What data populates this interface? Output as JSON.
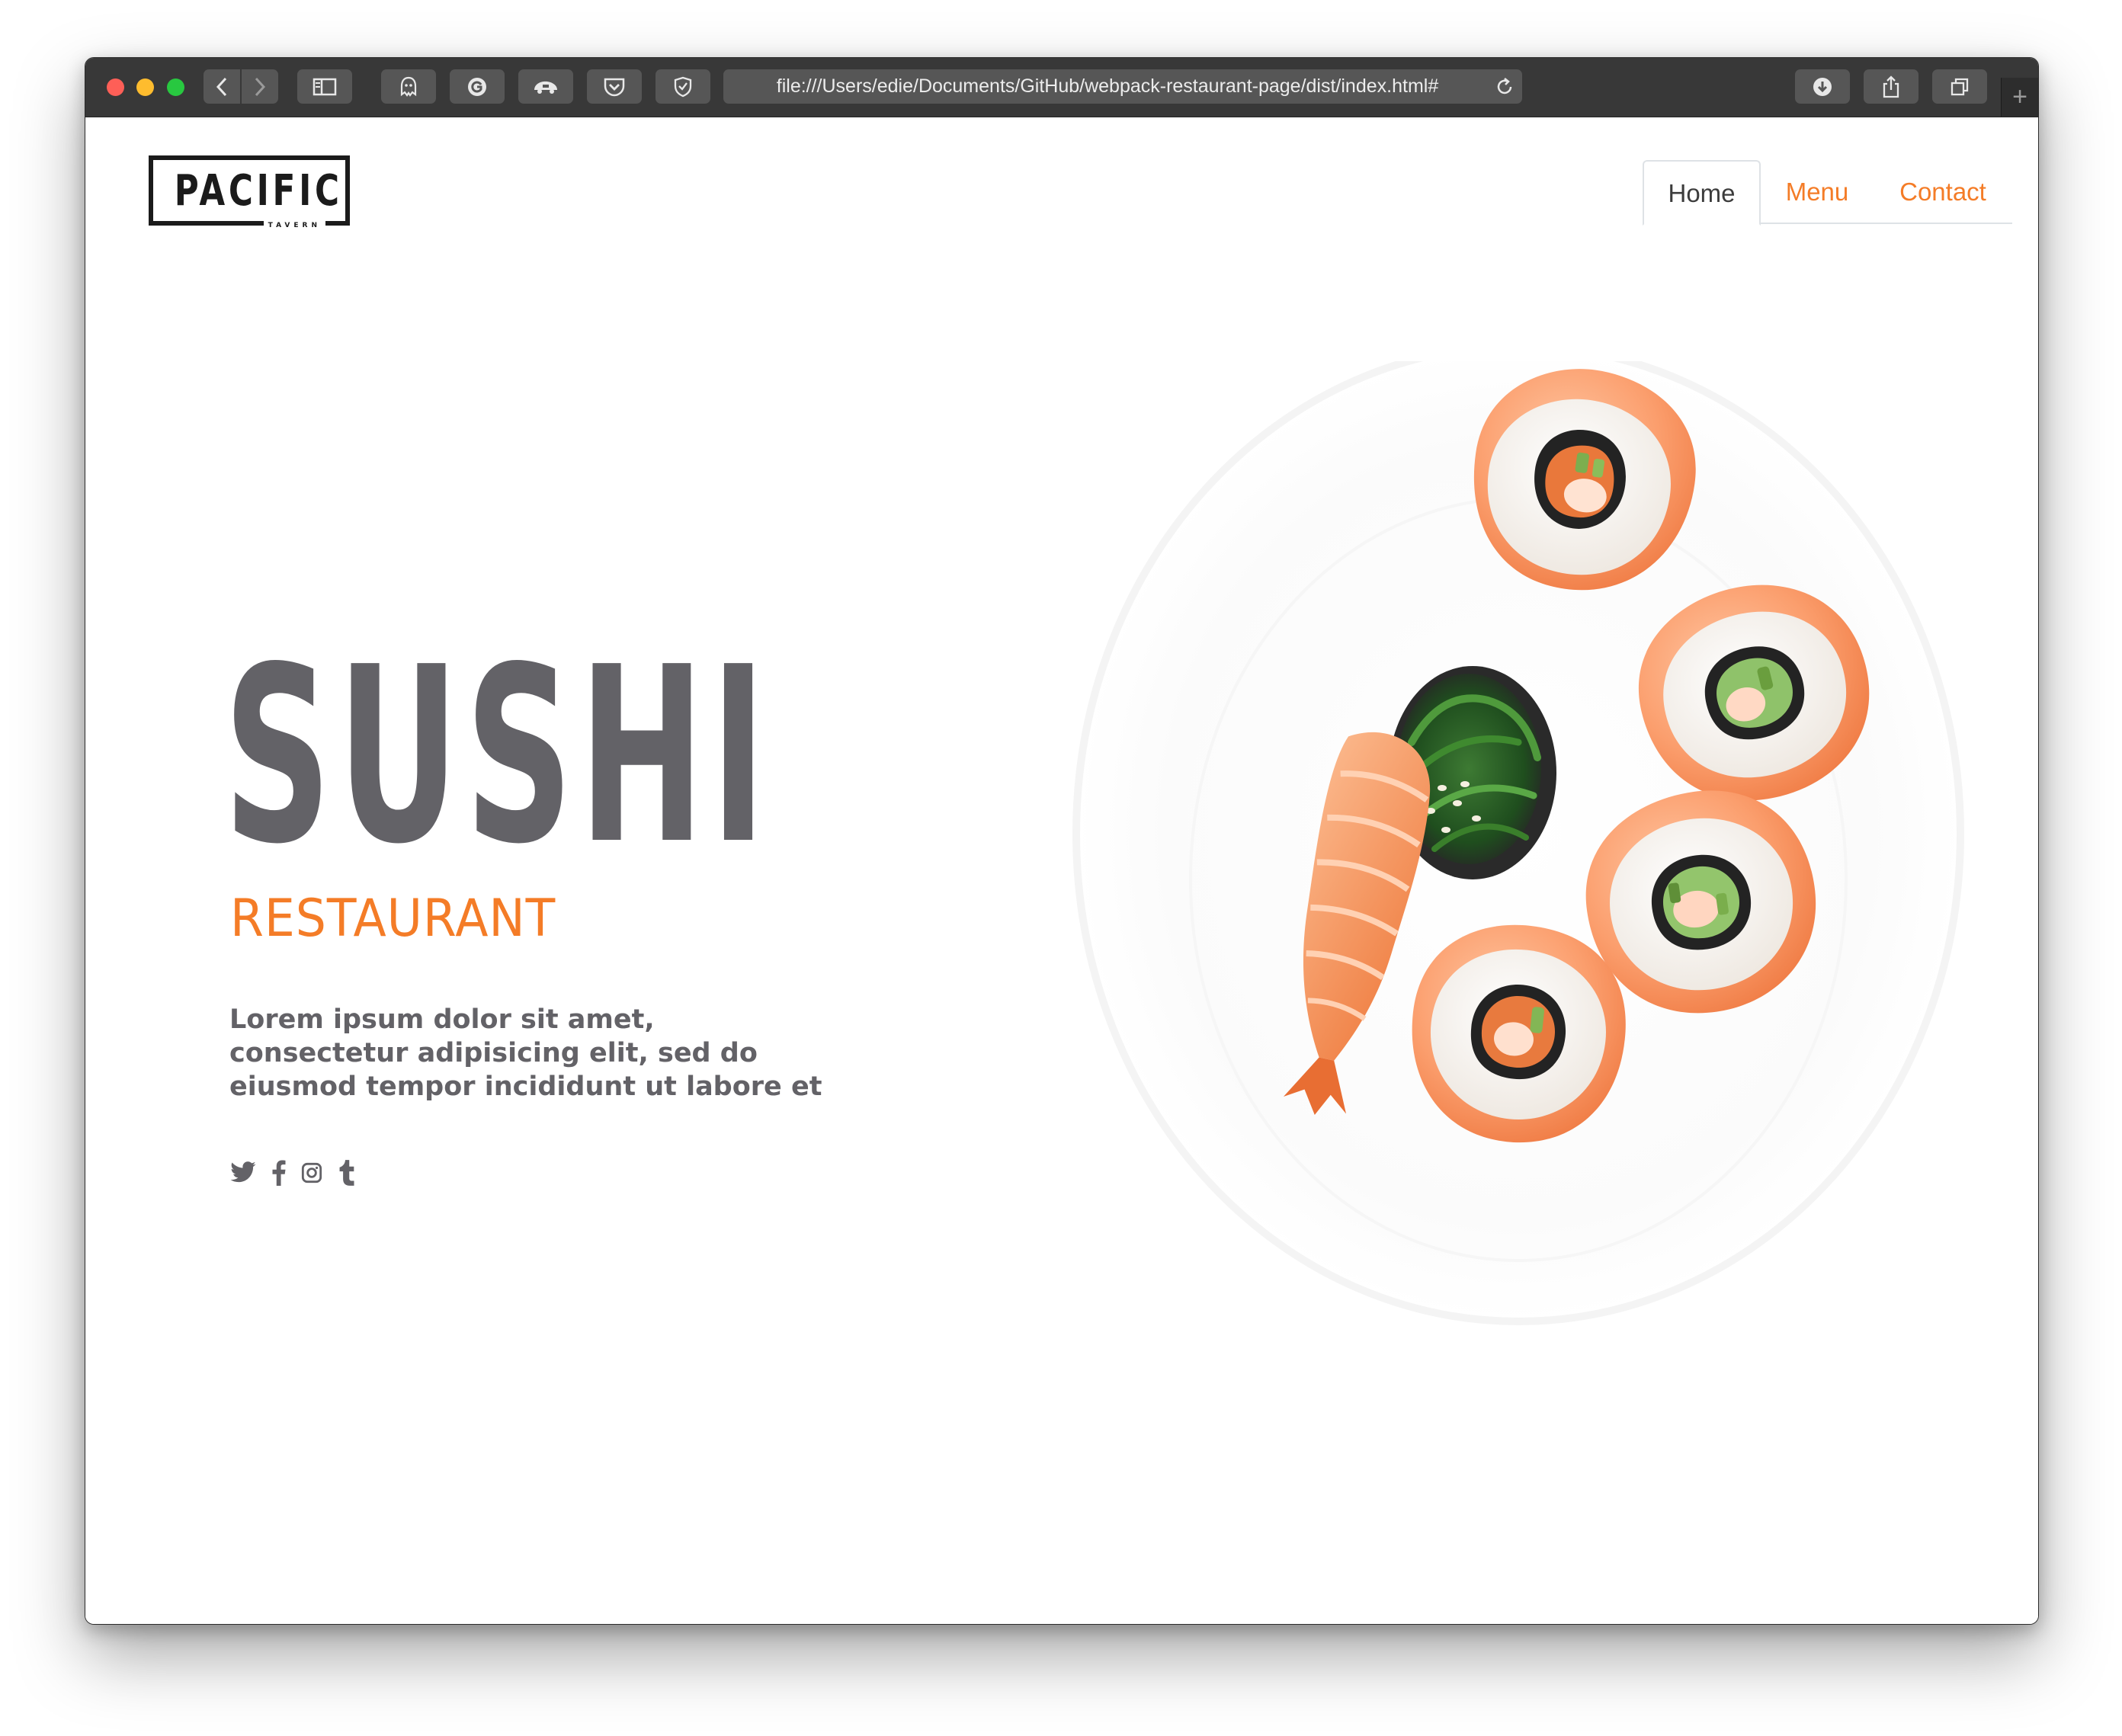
{
  "browser": {
    "url": "file:///Users/edie/Documents/GitHub/webpack-restaurant-page/dist/index.html#",
    "new_tab_glyph": "+",
    "toolbar_icons": [
      "back-icon",
      "forward-icon",
      "sidebar-icon",
      "ghostery-icon",
      "grammarly-icon",
      "extension-icon",
      "pocket-icon",
      "shield-icon",
      "reload-icon",
      "download-icon",
      "share-icon",
      "tabs-icon"
    ],
    "traffic_lights": {
      "close": "#fe5f57",
      "minimize": "#febc2e",
      "maximize": "#28c840"
    }
  },
  "site": {
    "logo": {
      "word": "PACIFIC",
      "sub": "TAVERN"
    },
    "nav": [
      {
        "label": "Home",
        "active": true
      },
      {
        "label": "Menu",
        "active": false
      },
      {
        "label": "Contact",
        "active": false
      }
    ],
    "hero": {
      "title": "SUSHI",
      "subtitle": "RESTAURANT",
      "lines": [
        "Lorem ipsum dolor sit amet,",
        "consectetur adipisicing elit, sed do",
        "eiusmod tempor incididunt ut labore et"
      ]
    },
    "socials": [
      "twitter-icon",
      "facebook-icon",
      "instagram-icon",
      "tumblr-icon"
    ],
    "colors": {
      "accent": "#f47c27",
      "text_gray": "#636267",
      "dark": "#1b1b1b"
    }
  }
}
